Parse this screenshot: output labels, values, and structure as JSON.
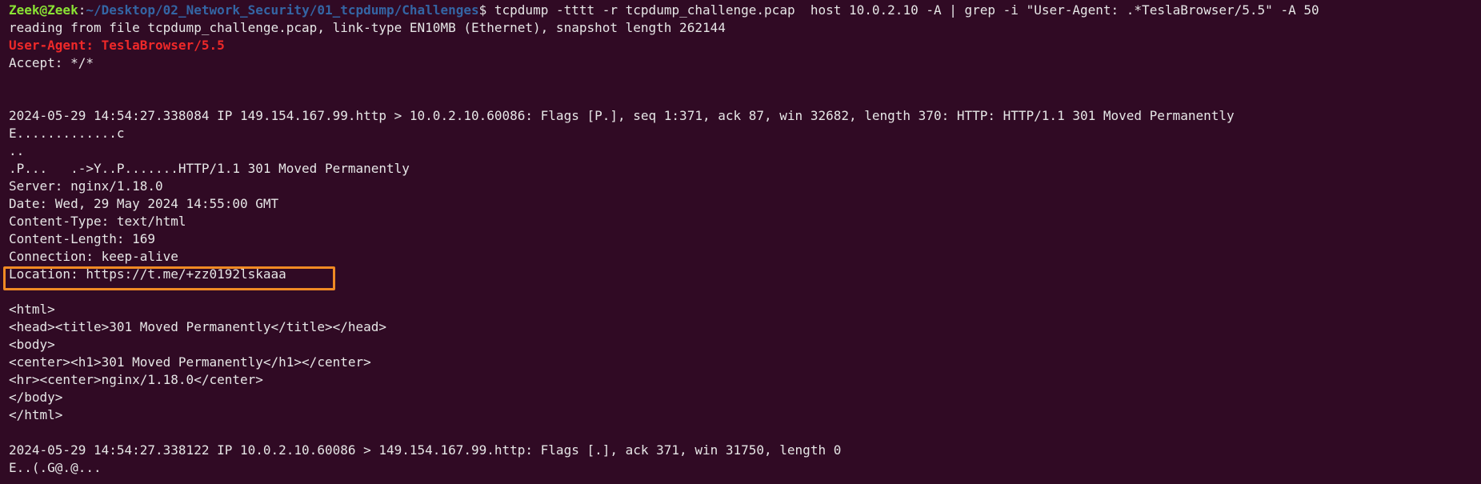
{
  "terminal": {
    "prompt": {
      "user_host": "Zeek@Zeek",
      "separator": ":",
      "path": "~/Desktop/02_Network_Security/01_tcpdump/Challenges",
      "symbol": "$",
      "command": " tcpdump -tttt -r tcpdump_challenge.pcap  host 10.0.2.10 -A | grep -i \"User-Agent: .*TeslaBrowser/5.5\" -A 50"
    },
    "output": [
      {
        "text": "reading from file tcpdump_challenge.pcap, link-type EN10MB (Ethernet), snapshot length 262144",
        "style": "normal"
      },
      {
        "text": "User-Agent: TeslaBrowser/5.5",
        "style": "match"
      },
      {
        "text": "Accept: */*",
        "style": "normal"
      },
      {
        "text": "",
        "style": "normal"
      },
      {
        "text": "",
        "style": "normal"
      },
      {
        "text": "2024-05-29 14:54:27.338084 IP 149.154.167.99.http > 10.0.2.10.60086: Flags [P.], seq 1:371, ack 87, win 32682, length 370: HTTP: HTTP/1.1 301 Moved Permanently",
        "style": "normal"
      },
      {
        "text": "E.............c",
        "style": "normal"
      },
      {
        "text": "..",
        "style": "normal"
      },
      {
        "text": ".P...   .->Y..P.......HTTP/1.1 301 Moved Permanently",
        "style": "normal"
      },
      {
        "text": "Server: nginx/1.18.0",
        "style": "normal"
      },
      {
        "text": "Date: Wed, 29 May 2024 14:55:00 GMT",
        "style": "normal"
      },
      {
        "text": "Content-Type: text/html",
        "style": "normal"
      },
      {
        "text": "Content-Length: 169",
        "style": "normal"
      },
      {
        "text": "Connection: keep-alive",
        "style": "normal"
      },
      {
        "text": "Location: https://t.me/+zz0192lskaaa",
        "style": "normal",
        "highlighted": true
      },
      {
        "text": "",
        "style": "normal"
      },
      {
        "text": "<html>",
        "style": "normal"
      },
      {
        "text": "<head><title>301 Moved Permanently</title></head>",
        "style": "normal"
      },
      {
        "text": "<body>",
        "style": "normal"
      },
      {
        "text": "<center><h1>301 Moved Permanently</h1></center>",
        "style": "normal"
      },
      {
        "text": "<hr><center>nginx/1.18.0</center>",
        "style": "normal"
      },
      {
        "text": "</body>",
        "style": "normal"
      },
      {
        "text": "</html>",
        "style": "normal"
      },
      {
        "text": "",
        "style": "normal"
      },
      {
        "text": "2024-05-29 14:54:27.338122 IP 10.0.2.10.60086 > 149.154.167.99.http: Flags [.], ack 371, win 31750, length 0",
        "style": "normal"
      },
      {
        "text": "E..(.G@.@...",
        "style": "normal"
      }
    ],
    "colors": {
      "background": "#300a24",
      "text": "#e6e6e6",
      "prompt_user": "#8ae234",
      "prompt_path": "#3465a4",
      "grep_match": "#ef2929",
      "highlight_box": "#f08a24"
    }
  }
}
